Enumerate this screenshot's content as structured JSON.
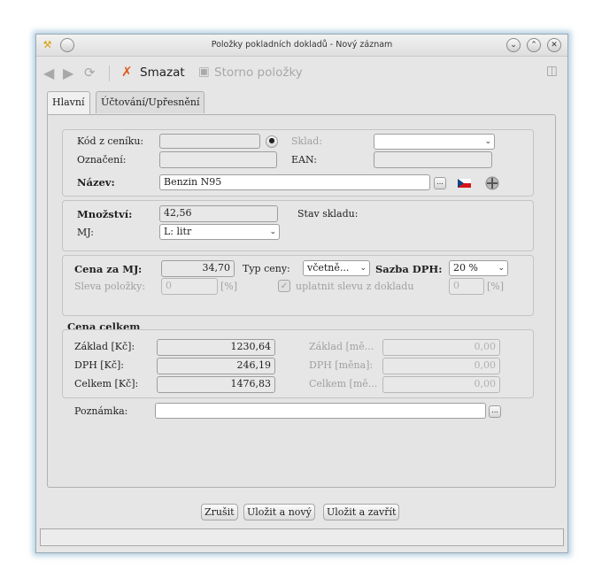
{
  "window": {
    "title": "Položky pokladních dokladů - Nový záznam"
  },
  "toolbar": {
    "delete_label": "Smazat",
    "cancel_item_label": "Storno položky"
  },
  "tabs": [
    "Hlavní",
    "Účtování/Upřesnění"
  ],
  "item": {
    "code_label": "Kód z ceníku:",
    "code_value": "",
    "warehouse_label": "Sklad:",
    "warehouse_value": "",
    "designation_label": "Označení:",
    "designation_value": "",
    "ean_label": "EAN:",
    "ean_value": "",
    "name_label": "Název:",
    "name_value": "Benzin N95"
  },
  "quantity": {
    "qty_label": "Množství:",
    "qty_value": "42,56",
    "stock_label": "Stav skladu:",
    "unit_label": "MJ:",
    "unit_value": "L: litr"
  },
  "price": {
    "unit_price_label": "Cena za MJ:",
    "unit_price_value": "34,70",
    "price_type_label": "Typ ceny:",
    "price_type_value": "včetně...",
    "vat_rate_label": "Sazba DPH:",
    "vat_rate_value": "20 %",
    "discount_label": "Sleva položky:",
    "discount_value": "0",
    "discount_unit": "[%]",
    "apply_discount_label": "uplatnit slevu z dokladu",
    "doc_discount_value": "0",
    "doc_discount_unit": "[%]"
  },
  "total": {
    "section_label": "Cena celkem",
    "base_label": "Základ [Kč]:",
    "base_value": "1230,64",
    "vat_label": "DPH [Kč]:",
    "vat_value": "246,19",
    "total_label": "Celkem [Kč]:",
    "total_value": "1476,83",
    "base_cur_label": "Základ [mě...",
    "base_cur_value": "0,00",
    "vat_cur_label": "DPH [měna]:",
    "vat_cur_value": "0,00",
    "total_cur_label": "Celkem [mě...",
    "total_cur_value": "0,00"
  },
  "note": {
    "label": "Poznámka:",
    "value": ""
  },
  "buttons": {
    "cancel": "Zrušit",
    "save_new": "Uložit a nový",
    "save_close": "Uložit a zavřít"
  }
}
